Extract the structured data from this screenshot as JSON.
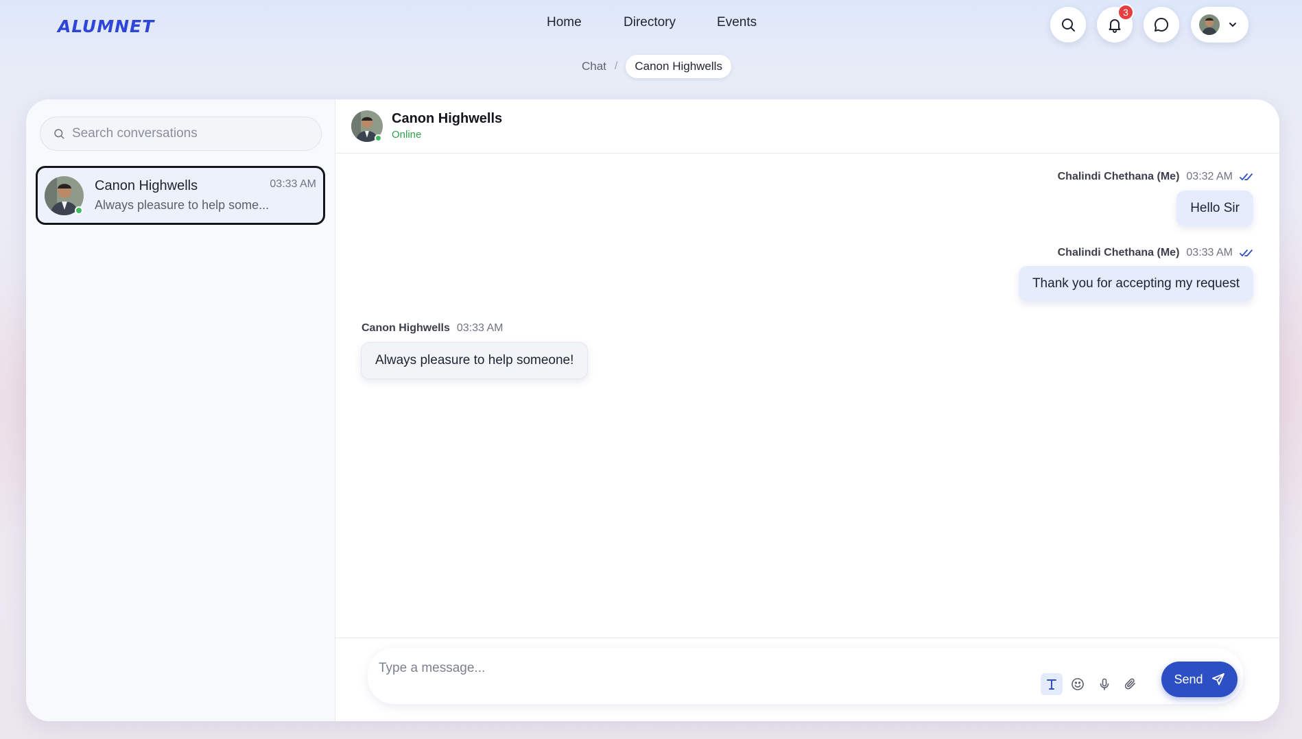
{
  "app": {
    "logo_text": "ALUMNET",
    "brand_color": "#2f45d8"
  },
  "nav": {
    "items": [
      {
        "label": "Home"
      },
      {
        "label": "Directory"
      },
      {
        "label": "Events"
      }
    ]
  },
  "breadcrumb": {
    "parent": "Chat",
    "separator": "/",
    "current": "Canon Highwells"
  },
  "header_actions": {
    "search_icon": "search-icon",
    "notifications_icon": "bell-icon",
    "notifications_count": "3",
    "messages_icon": "chat-bubble-icon",
    "profile_menu_icon": "chevron-down-icon"
  },
  "sidebar": {
    "search_placeholder": "Search conversations",
    "conversations": [
      {
        "name": "Canon Highwells",
        "time": "03:33 AM",
        "preview": "Always pleasure to help some...",
        "online": true
      }
    ]
  },
  "chat": {
    "contact_name": "Canon Highwells",
    "contact_status": "Online",
    "messages": [
      {
        "sender": "Chalindi Chethana (Me)",
        "time": "03:32 AM",
        "text": "Hello Sir",
        "mine": true,
        "read_icon": "double-check-icon"
      },
      {
        "sender": "Chalindi Chethana (Me)",
        "time": "03:33 AM",
        "text": "Thank you for accepting my request",
        "mine": true,
        "read_icon": "double-check-icon"
      },
      {
        "sender": "Canon Highwells",
        "time": "03:33 AM",
        "text": "Always pleasure to help someone!",
        "mine": false
      }
    ]
  },
  "composer": {
    "placeholder": "Type a message...",
    "tools": [
      "text-format-icon",
      "emoji-icon",
      "microphone-icon",
      "paperclip-icon"
    ],
    "send_label": "Send",
    "send_color": "#2d4fc4"
  },
  "colors": {
    "online": "#3dbb5e",
    "badge": "#e53e3e",
    "my_bubble": "#e5ecfb"
  }
}
